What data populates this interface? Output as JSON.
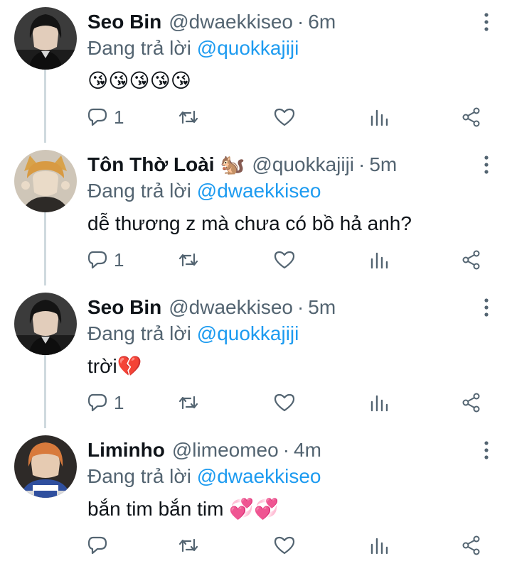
{
  "reply_prefix": "Đang trả lời",
  "icons": {
    "reply": "reply-icon",
    "retweet": "retweet-icon",
    "like": "heart-icon",
    "stats": "analytics-icon",
    "share": "share-icon",
    "more": "more-vertical-icon"
  },
  "colors": {
    "link": "#1d9bf0",
    "secondary": "#536471",
    "thread_line": "#cfd9de"
  },
  "tweets": [
    {
      "name": "Seo Bin",
      "badge": "",
      "handle": "@dwaekkiseo",
      "time": "6m",
      "mention": "@quokkajiji",
      "text": "",
      "emoji": "😘😘😘😘😘",
      "reply_count": "1"
    },
    {
      "name": "Tôn Thờ Loài",
      "badge": "🐿️",
      "handle": "@quokkajiji",
      "time": "5m",
      "mention": "@dwaekkiseo",
      "text": "dễ thương z mà chưa có bồ hả anh?",
      "emoji": "",
      "reply_count": "1"
    },
    {
      "name": "Seo Bin",
      "badge": "",
      "handle": "@dwaekkiseo",
      "time": "5m",
      "mention": "@quokkajiji",
      "text": "trời",
      "emoji": "💔",
      "reply_count": "1"
    },
    {
      "name": "Liminho",
      "badge": "",
      "handle": "@limeomeo",
      "time": "4m",
      "mention": "@dwaekkiseo",
      "text": "bắn tim bắn tim ",
      "emoji": "💞💞",
      "reply_count": ""
    }
  ]
}
